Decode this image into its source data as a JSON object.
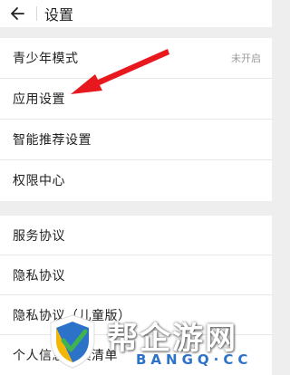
{
  "header": {
    "title": "设置"
  },
  "group1": {
    "items": [
      {
        "label": "青少年模式",
        "value": "未开启"
      },
      {
        "label": "应用设置"
      },
      {
        "label": "智能推荐设置"
      },
      {
        "label": "权限中心"
      }
    ]
  },
  "group2": {
    "items": [
      {
        "label": "服务协议"
      },
      {
        "label": "隐私协议"
      },
      {
        "label": "隐私协议（儿童版）"
      },
      {
        "label": "个人信息收集清单"
      }
    ]
  },
  "watermark": {
    "text": "帮企游网",
    "sub": "BANGQ·CC"
  },
  "colors": {
    "arrow": "#e8191e",
    "accent_text": "#2d72c9"
  }
}
